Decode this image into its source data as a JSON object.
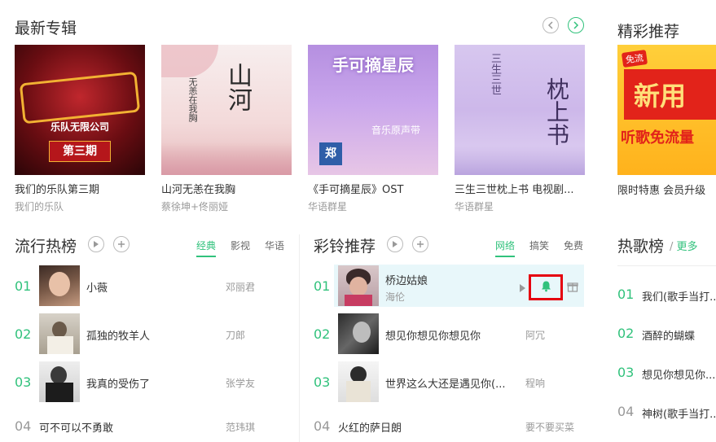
{
  "new_albums": {
    "title": "最新专辑",
    "albums": [
      {
        "name": "我们的乐队第三期",
        "artist": "我们的乐队",
        "cover_text": "乐队无限公司",
        "cover_sub": "第三期"
      },
      {
        "name": "山河无恙在我胸",
        "artist": "蔡徐坤+佟丽娅",
        "cover_text": "山河",
        "cover_sub": "无恙在我胸"
      },
      {
        "name": "《手可摘星辰》OST",
        "artist": "华语群星",
        "cover_text": "手可摘星辰",
        "cover_sub": "音乐原声带"
      },
      {
        "name": "三生三世枕上书 电视剧...",
        "artist": "华语群星",
        "cover_text": "枕上书",
        "cover_sub": "三生三世"
      }
    ]
  },
  "featured": {
    "title": "精彩推荐",
    "banner_tag": "免流",
    "banner_line1": "新用",
    "banner_line2": "听歌免流量",
    "caption": "限时特惠 会员升级"
  },
  "popular_chart": {
    "title": "流行热榜",
    "tabs": [
      "经典",
      "影视",
      "华语"
    ],
    "items": [
      {
        "rank": "01",
        "song": "小薇",
        "singer": "邓丽君"
      },
      {
        "rank": "02",
        "song": "孤独的牧羊人",
        "singer": "刀郎"
      },
      {
        "rank": "03",
        "song": "我真的受伤了",
        "singer": "张学友"
      },
      {
        "rank": "04",
        "song": "可不可以不勇敢",
        "singer": "范玮琪"
      }
    ]
  },
  "ringtone_chart": {
    "title": "彩铃推荐",
    "tabs": [
      "网络",
      "搞笑",
      "免费"
    ],
    "items": [
      {
        "rank": "01",
        "song": "桥边姑娘",
        "singer": "海伦"
      },
      {
        "rank": "02",
        "song": "想见你想见你想见你",
        "singer": "阿冗"
      },
      {
        "rank": "03",
        "song": "世界这么大还是遇见你(...",
        "singer": "程响"
      },
      {
        "rank": "04",
        "song": "火红的萨日朗",
        "singer": "要不要买菜"
      }
    ]
  },
  "hot_chart": {
    "title": "热歌榜",
    "more": "更多",
    "items": [
      {
        "rank": "01",
        "song": "我们(歌手当打..."
      },
      {
        "rank": "02",
        "song": "酒醉的蝴蝶"
      },
      {
        "rank": "03",
        "song": "想见你想见你..."
      },
      {
        "rank": "04",
        "song": "神树(歌手当打..."
      }
    ]
  },
  "colors": {
    "accent": "#31c27c",
    "highlight_row": "#e8f7fa",
    "alert_box": "#e5000f"
  }
}
